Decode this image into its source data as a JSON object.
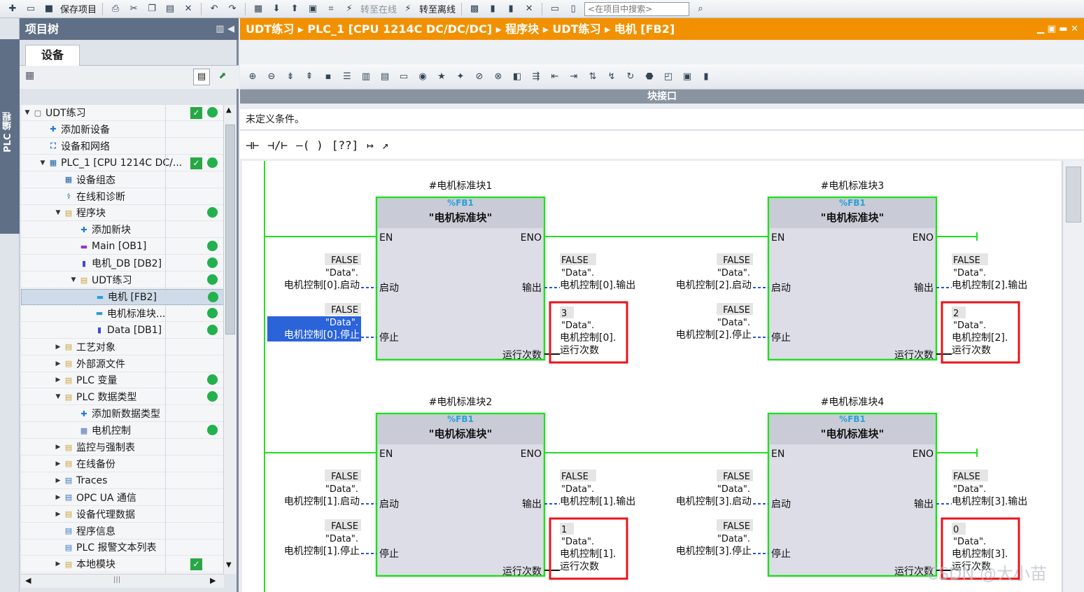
{
  "toolbar": {
    "save_project": "保存项目",
    "go_online": "转至在线",
    "go_offline": "转至离线",
    "search_placeholder": "<在项目中搜索>"
  },
  "side_tab": {
    "label": "PLC 编程"
  },
  "tree": {
    "header": "项目树",
    "tab": "设备",
    "items": [
      {
        "label": "UDT练习",
        "check": true,
        "status": true
      },
      {
        "label": "添加新设备"
      },
      {
        "label": "设备和网络"
      },
      {
        "label": "PLC_1 [CPU 1214C DC/...",
        "check": true,
        "status": true
      },
      {
        "label": "设备组态"
      },
      {
        "label": "在线和诊断"
      },
      {
        "label": "程序块",
        "status": true
      },
      {
        "label": "添加新块"
      },
      {
        "label": "Main [OB1]",
        "status": true
      },
      {
        "label": "电机_DB [DB2]",
        "status": true
      },
      {
        "label": "UDT练习",
        "status": true
      },
      {
        "label": "电机 [FB2]",
        "status": true
      },
      {
        "label": "电机标准块...",
        "status": true
      },
      {
        "label": "Data [DB1]",
        "status": true
      },
      {
        "label": "工艺对象"
      },
      {
        "label": "外部源文件"
      },
      {
        "label": "PLC 变量",
        "status": true
      },
      {
        "label": "PLC 数据类型",
        "status": true
      },
      {
        "label": "添加新数据类型"
      },
      {
        "label": "电机控制",
        "status": true
      },
      {
        "label": "监控与强制表"
      },
      {
        "label": "在线备份"
      },
      {
        "label": "Traces"
      },
      {
        "label": "OPC UA 通信"
      },
      {
        "label": "设备代理数据"
      },
      {
        "label": "程序信息"
      },
      {
        "label": "PLC 报警文本列表"
      },
      {
        "label": "本地模块",
        "check": true
      }
    ]
  },
  "editor": {
    "breadcrumb": [
      "UDT练习",
      "PLC_1 [CPU 1214C DC/DC/DC]",
      "程序块",
      "UDT练习",
      "电机 [FB2]"
    ],
    "block_interface": "块接口",
    "condition": "未定义条件。"
  },
  "lad": {
    "blocks": [
      {
        "instance": "#电机标准块1",
        "ref": "%FB1",
        "name": "\"电机标准块\"",
        "start_val": "FALSE",
        "start_tag": "电机控制[0].启动",
        "stop_val": "FALSE",
        "stop_tag": "电机控制[0].停止",
        "out_val": "FALSE",
        "out_tag": "电机控制[0].输出",
        "count_val": "3",
        "count_tag_1": "电机控制[0].",
        "count_tag_2": "运行次数"
      },
      {
        "instance": "#电机标准块3",
        "ref": "%FB1",
        "name": "\"电机标准块\"",
        "start_val": "FALSE",
        "start_tag": "电机控制[2].启动",
        "stop_val": "FALSE",
        "stop_tag": "电机控制[2].停止",
        "out_val": "FALSE",
        "out_tag": "电机控制[2].输出",
        "count_val": "2",
        "count_tag_1": "电机控制[2].",
        "count_tag_2": "运行次数"
      },
      {
        "instance": "#电机标准块2",
        "ref": "%FB1",
        "name": "\"电机标准块\"",
        "start_val": "FALSE",
        "start_tag": "电机控制[1].启动",
        "stop_val": "FALSE",
        "stop_tag": "电机控制[1].停止",
        "out_val": "FALSE",
        "out_tag": "电机控制[1].输出",
        "count_val": "1",
        "count_tag_1": "电机控制[1].",
        "count_tag_2": "运行次数"
      },
      {
        "instance": "#电机标准块4",
        "ref": "%FB1",
        "name": "\"电机标准块\"",
        "start_val": "FALSE",
        "start_tag": "电机控制[3].启动",
        "stop_val": "FALSE",
        "stop_tag": "电机控制[3].停止",
        "out_val": "FALSE",
        "out_tag": "电机控制[3].输出",
        "count_val": "0",
        "count_tag_1": "电机控制[3].",
        "count_tag_2": "运行次数"
      }
    ],
    "pins": {
      "en": "EN",
      "eno": "ENO",
      "start": "启动",
      "stop": "停止",
      "output": "输出",
      "count": "运行次数",
      "db": "\"Data\"."
    }
  },
  "watermark": "CSDN @大小苗",
  "colors": {
    "accent": "#f29100",
    "box_green": "#22dd22",
    "highlight_red": "#e8141b",
    "tag_blue": "#2455d6"
  }
}
